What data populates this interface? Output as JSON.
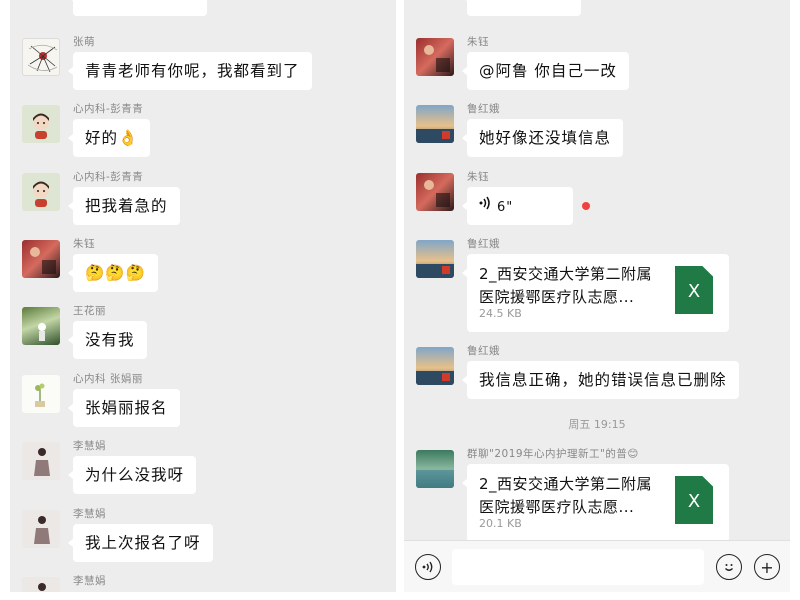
{
  "left": {
    "messages": [
      {
        "sender": "张萌",
        "text": "青青老师有你呢，我都看到了"
      },
      {
        "sender": "心内科-彭青青",
        "text": "好的👌"
      },
      {
        "sender": "心内科-彭青青",
        "text": "把我着急的"
      },
      {
        "sender": "朱钰",
        "text": "🤔🤔🤔"
      },
      {
        "sender": "王花丽",
        "text": "没有我"
      },
      {
        "sender": "心内科 张娟丽",
        "text": "张娟丽报名"
      },
      {
        "sender": "李慧娟",
        "text": "为什么没我呀"
      },
      {
        "sender": "李慧娟",
        "text": "我上次报名了呀"
      },
      {
        "sender": "李慧娟",
        "text": ""
      }
    ]
  },
  "right": {
    "messages": [
      {
        "sender": "朱钰",
        "text": "@阿鲁 你自己一改"
      },
      {
        "sender": "鲁红娥",
        "text": "她好像还没填信息"
      },
      {
        "sender": "朱钰",
        "voice_duration": "6\""
      },
      {
        "sender": "鲁红娥",
        "file_name": "2_西安交通大学第二附属医院援鄂医疗队志愿...",
        "file_size": "24.5 KB",
        "file_icon": "X"
      },
      {
        "sender": "鲁红娥",
        "text": "我信息正确，她的错误信息已删除"
      },
      {
        "sender": "群聊\"2019年心内护理新工\"的普😊",
        "file_name": "2_西安交通大学第二附属医院援鄂医疗队志愿...",
        "file_size": "20.1 KB",
        "file_icon": "X"
      }
    ],
    "timestamp": "周五 19:15"
  },
  "input_bar": {
    "voice_icon": "voice-icon",
    "emoji_icon": "emoji-icon",
    "add_icon": "add-icon",
    "add_symbol": "+"
  },
  "colors": {
    "background": "#ededed",
    "bubble": "#ffffff",
    "excel_green": "#1f7a45",
    "unread_dot": "#f04040"
  }
}
